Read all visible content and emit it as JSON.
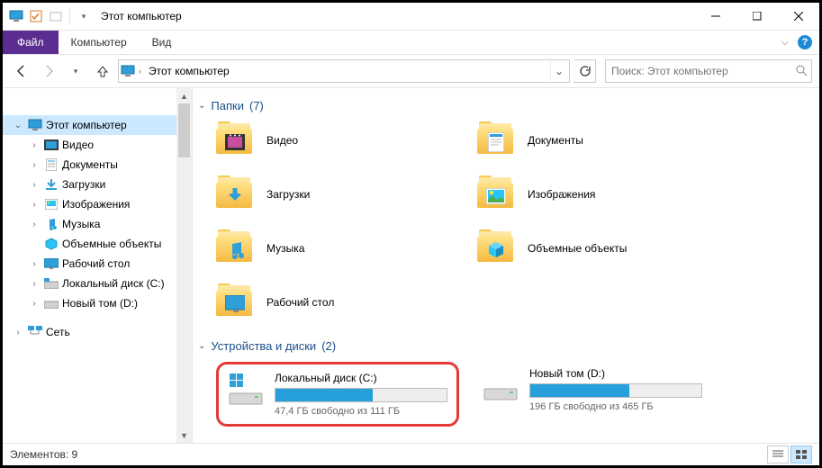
{
  "window": {
    "title": "Этот компьютер"
  },
  "menubar": {
    "file": "Файл",
    "computer": "Компьютер",
    "view": "Вид"
  },
  "breadcrumb": {
    "root": "Этот компьютер"
  },
  "search": {
    "placeholder": "Поиск: Этот компьютер"
  },
  "sidebar": {
    "root": "Этот компьютер",
    "items": [
      {
        "label": "Видео"
      },
      {
        "label": "Документы"
      },
      {
        "label": "Загрузки"
      },
      {
        "label": "Изображения"
      },
      {
        "label": "Музыка"
      },
      {
        "label": "Объемные объекты"
      },
      {
        "label": "Рабочий стол"
      },
      {
        "label": "Локальный диск (C:)"
      },
      {
        "label": "Новый том (D:)"
      }
    ],
    "network": "Сеть"
  },
  "groups": {
    "folders": {
      "title": "Папки",
      "count": "(7)"
    },
    "drives": {
      "title": "Устройства и диски",
      "count": "(2)"
    }
  },
  "folders": [
    {
      "label": "Видео"
    },
    {
      "label": "Документы"
    },
    {
      "label": "Загрузки"
    },
    {
      "label": "Изображения"
    },
    {
      "label": "Музыка"
    },
    {
      "label": "Объемные объекты"
    },
    {
      "label": "Рабочий стол"
    }
  ],
  "drives": [
    {
      "name": "Локальный диск (C:)",
      "free_text": "47,4 ГБ свободно из 111 ГБ",
      "fill_pct": 57,
      "highlighted": true,
      "os": true
    },
    {
      "name": "Новый том (D:)",
      "free_text": "196 ГБ свободно из 465 ГБ",
      "fill_pct": 58,
      "highlighted": false,
      "os": false
    }
  ],
  "statusbar": {
    "items_label": "Элементов: 9"
  }
}
